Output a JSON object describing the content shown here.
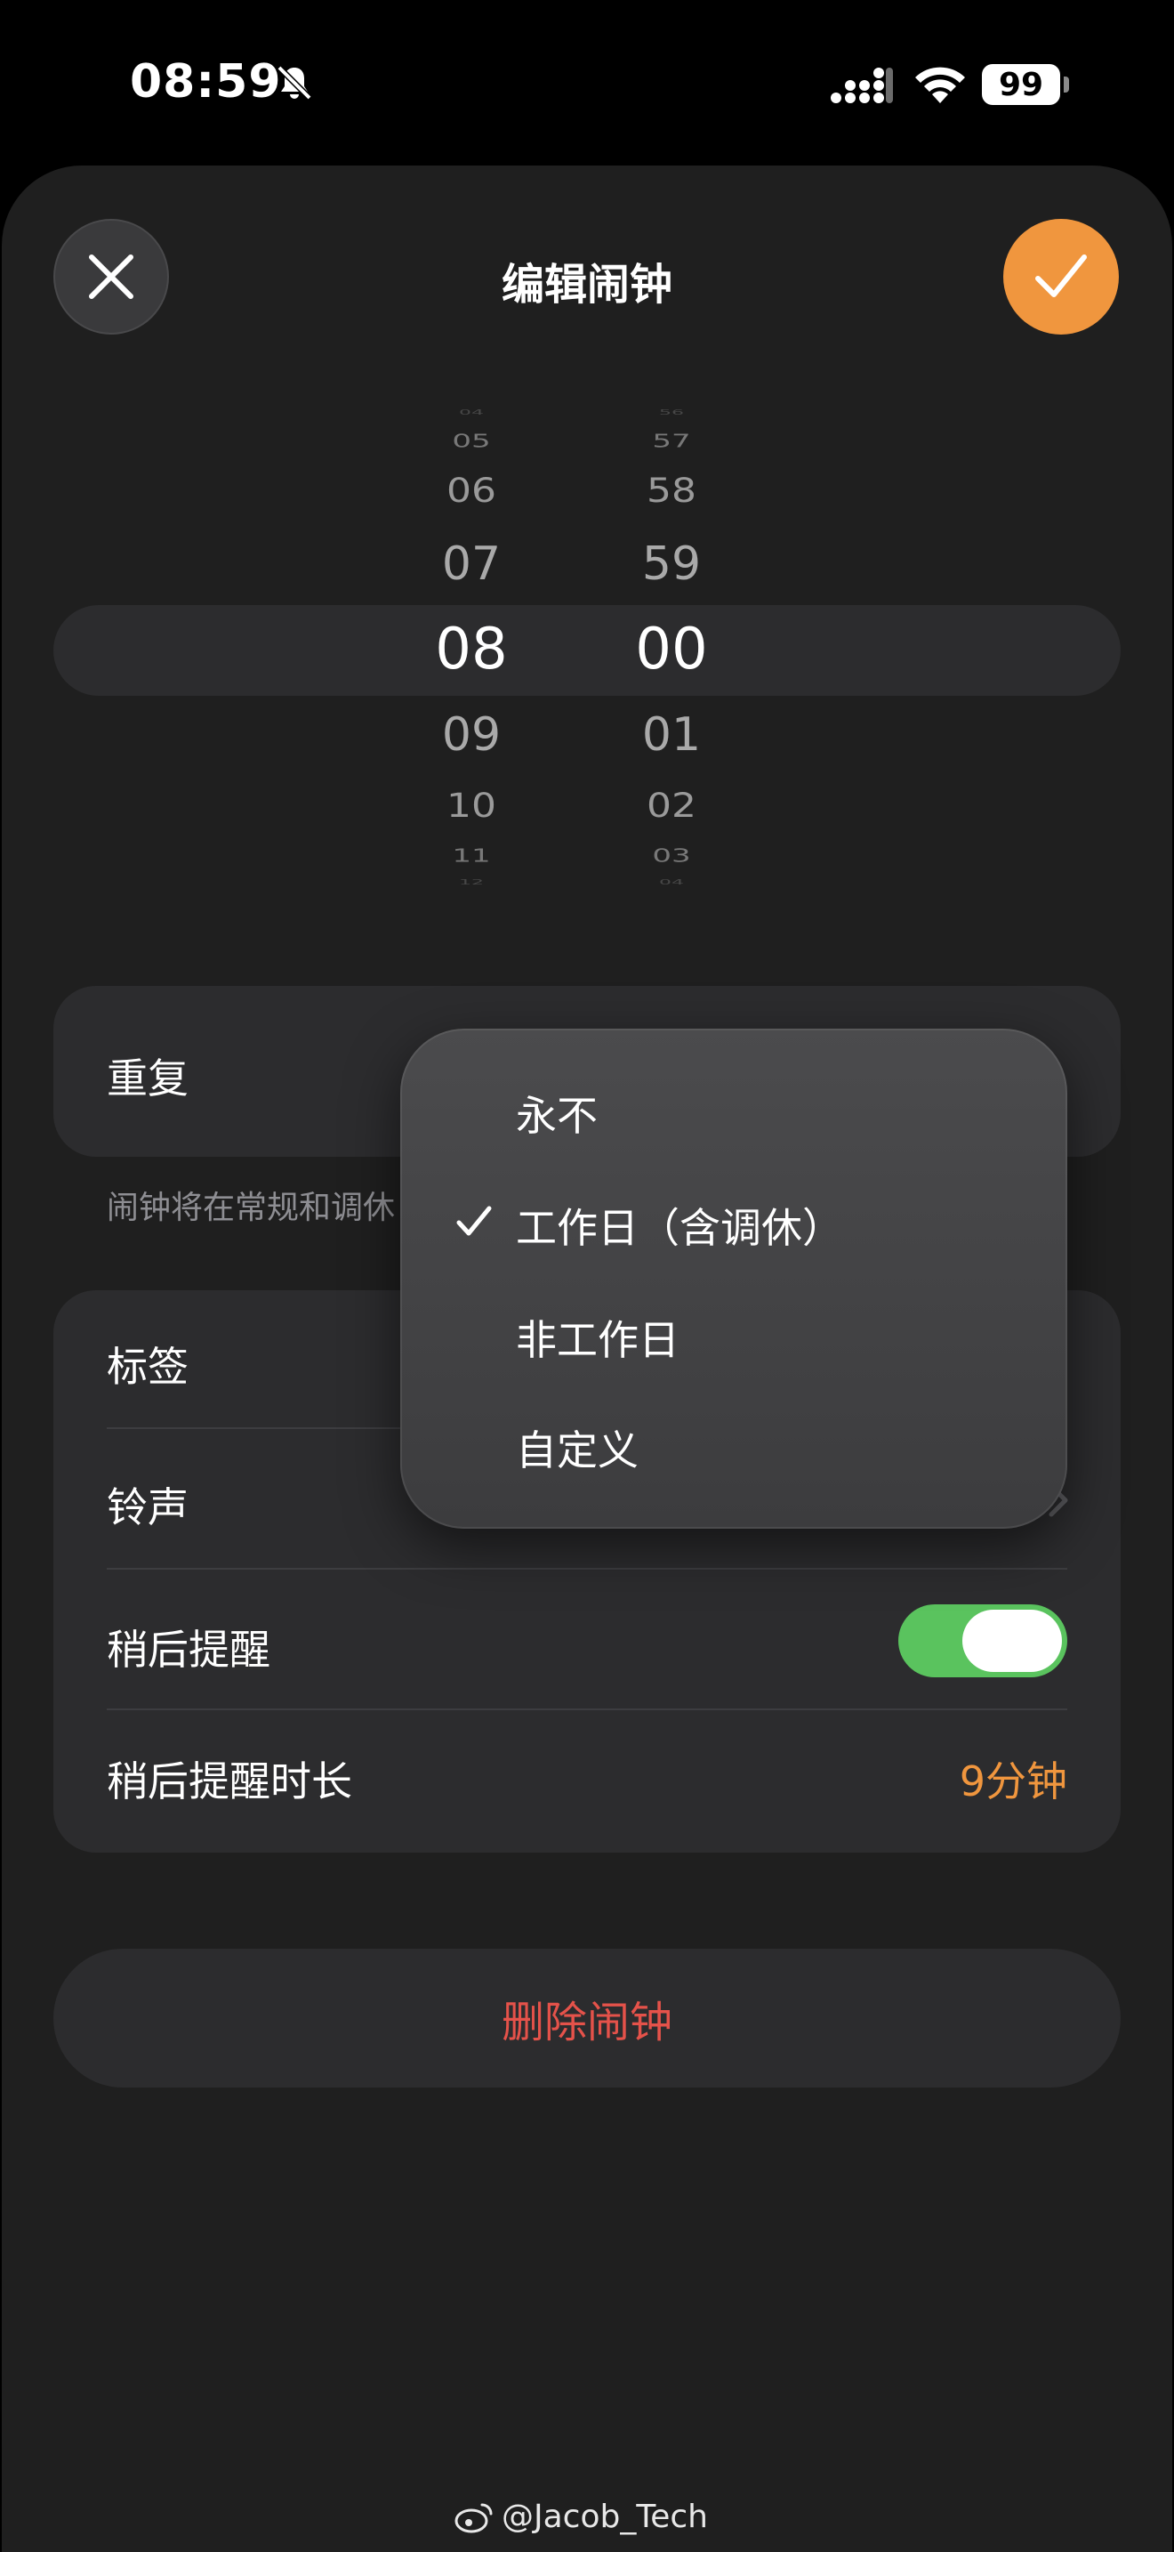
{
  "status_bar": {
    "time": "08:59",
    "battery": "99"
  },
  "header": {
    "title": "编辑闹钟"
  },
  "picker": {
    "hours": [
      "04",
      "05",
      "06",
      "07",
      "08",
      "09",
      "10",
      "11",
      "12"
    ],
    "minutes": [
      "56",
      "57",
      "58",
      "59",
      "00",
      "01",
      "02",
      "03",
      "04"
    ],
    "selected_hour": "08",
    "selected_minute": "00"
  },
  "repeat": {
    "label": "重复",
    "footnote": "闹钟将在常规和调休"
  },
  "settings": {
    "label_row": "标签",
    "sound_row": "铃声",
    "snooze_row": "稍后提醒",
    "snooze_on": true,
    "snooze_duration_row": "稍后提醒时长",
    "snooze_duration_value": "9分钟"
  },
  "delete_button": "删除闹钟",
  "repeat_menu": {
    "items": [
      {
        "label": "永不",
        "checked": false
      },
      {
        "label": "工作日（含调休）",
        "checked": true
      },
      {
        "label": "非工作日",
        "checked": false
      },
      {
        "label": "自定义",
        "checked": false
      }
    ]
  },
  "watermark": "@Jacob_Tech",
  "colors": {
    "accent": "#f0963e",
    "destructive": "#e5524a",
    "toggle_on": "#5ac35e",
    "sheet_bg": "#1f1f1f",
    "card_bg": "#2c2c2e"
  }
}
